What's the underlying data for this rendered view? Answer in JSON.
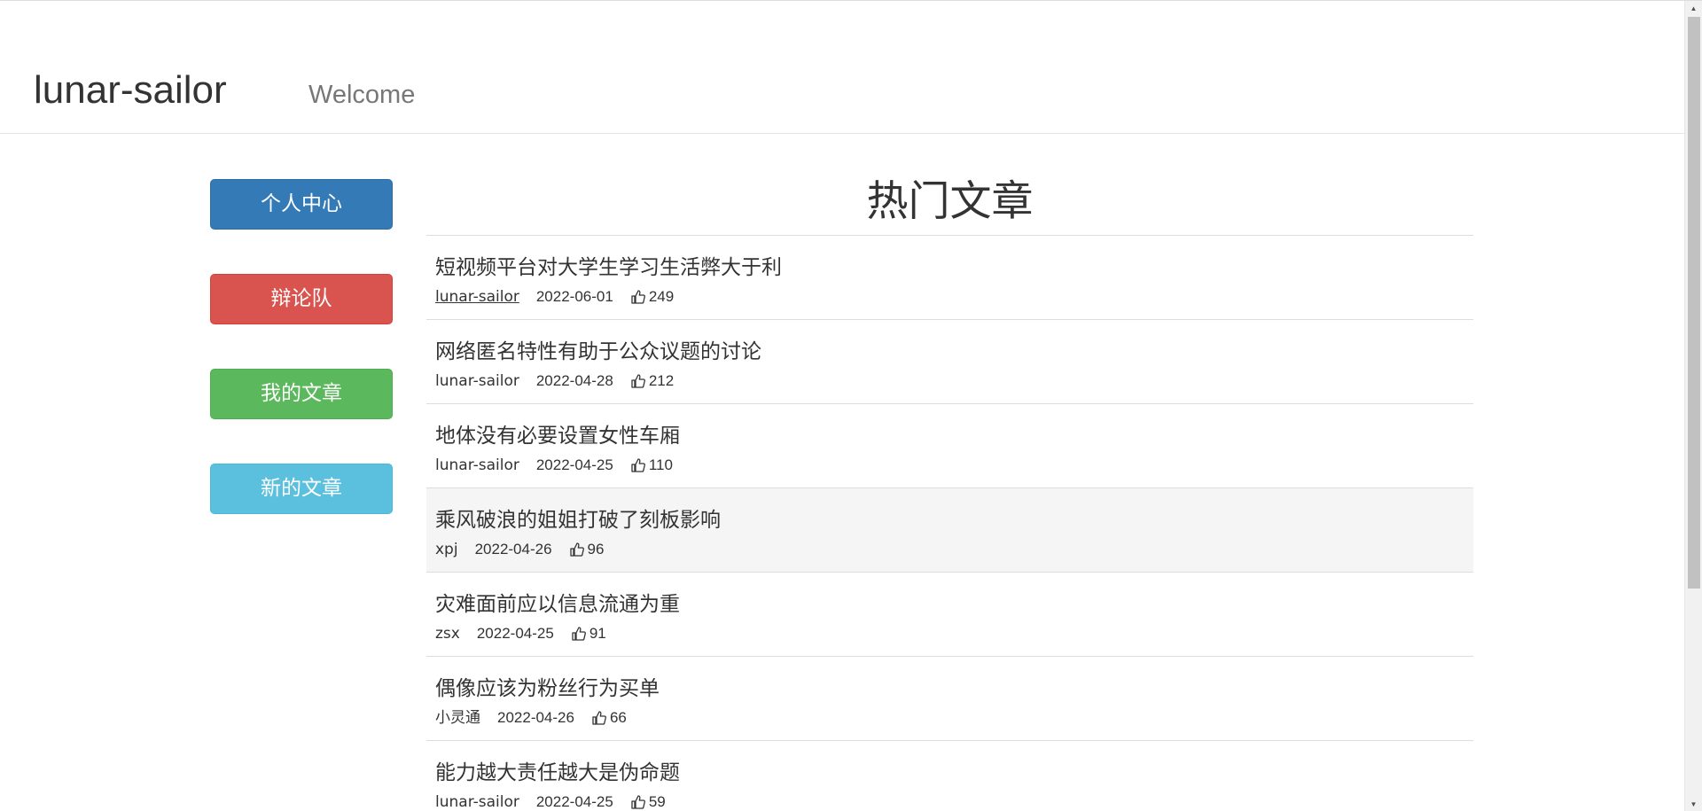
{
  "header": {
    "brand": "lunar-sailor",
    "welcome": "Welcome"
  },
  "sidebar": {
    "buttons": [
      {
        "label": "个人中心",
        "color": "#337ab7"
      },
      {
        "label": "辩论队",
        "color": "#d9534f"
      },
      {
        "label": "我的文章",
        "color": "#5cb85c"
      },
      {
        "label": "新的文章",
        "color": "#5bc0de"
      }
    ]
  },
  "main": {
    "title": "热门文章",
    "articles": [
      {
        "title": "短视频平台对大学生学习生活弊大于利",
        "author": "lunar-sailor",
        "date": "2022-06-01",
        "likes": "249"
      },
      {
        "title": "网络匿名特性有助于公众议题的讨论",
        "author": "lunar-sailor",
        "date": "2022-04-28",
        "likes": "212"
      },
      {
        "title": "地体没有必要设置女性车厢",
        "author": "lunar-sailor",
        "date": "2022-04-25",
        "likes": "110"
      },
      {
        "title": "乘风破浪的姐姐打破了刻板影响",
        "author": "xpj",
        "date": "2022-04-26",
        "likes": "96"
      },
      {
        "title": "灾难面前应以信息流通为重",
        "author": "zsx",
        "date": "2022-04-25",
        "likes": "91"
      },
      {
        "title": "偶像应该为粉丝行为买单",
        "author": "小灵通",
        "date": "2022-04-26",
        "likes": "66"
      },
      {
        "title": "能力越大责任越大是伪命题",
        "author": "lunar-sailor",
        "date": "2022-04-25",
        "likes": "59"
      }
    ]
  },
  "icons": {
    "like": "thumbs-up-icon"
  }
}
